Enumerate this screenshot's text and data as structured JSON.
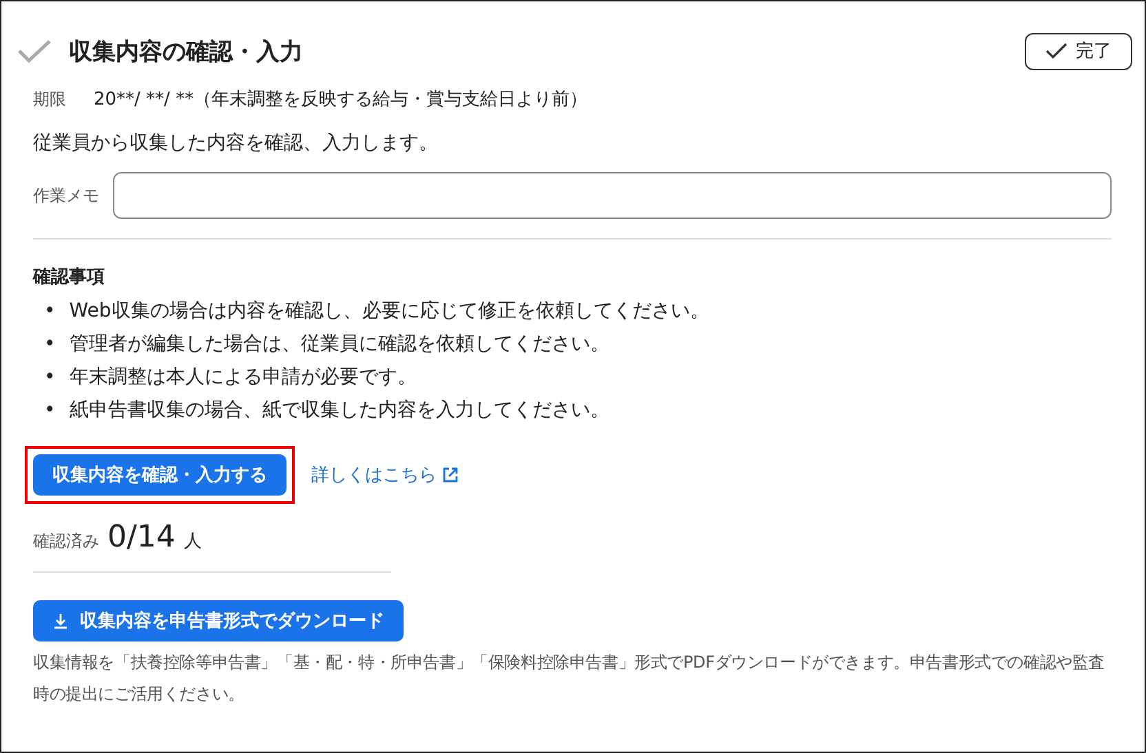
{
  "task": {
    "title": "収集内容の確認・入力",
    "completed": false,
    "complete_button": "完了"
  },
  "deadline": {
    "label": "期限",
    "value": "20**/ **/ **（年末調整を反映する給与・賞与支給日より前）"
  },
  "description": "従業員から収集した内容を確認、入力します。",
  "memo": {
    "label": "作業メモ"
  },
  "checklist": {
    "heading": "確認事項",
    "items": [
      {
        "marker": "•",
        "text": "Web収集の場合は内容を確認し、必要に応じて修正を依頼してください。"
      },
      {
        "marker": "•",
        "text": "管理者が編集した場合は、従業員に確認を依頼してください。"
      },
      {
        "marker": "•",
        "text": "年末調整は本人による申請が必要です。"
      },
      {
        "marker": "•",
        "text": "紙申告書収集の場合、紙で収集した内容を入力してください。"
      }
    ]
  },
  "primary_button": {
    "label": "収集内容を確認・入力する",
    "highlighted": true
  },
  "help_link": "詳しくはこちら",
  "progress": {
    "label": "確認済み",
    "count": "0/14",
    "unit": "人"
  },
  "download_button": "収集内容を申告書形式でダウンロード",
  "download_note": "収集情報を「扶養控除等申告書」「基・配・特・所申告書」「保険料控除申告書」形式でPDFダウンロードができます。申告書形式での確認や監査時の提出にご活用ください。"
}
